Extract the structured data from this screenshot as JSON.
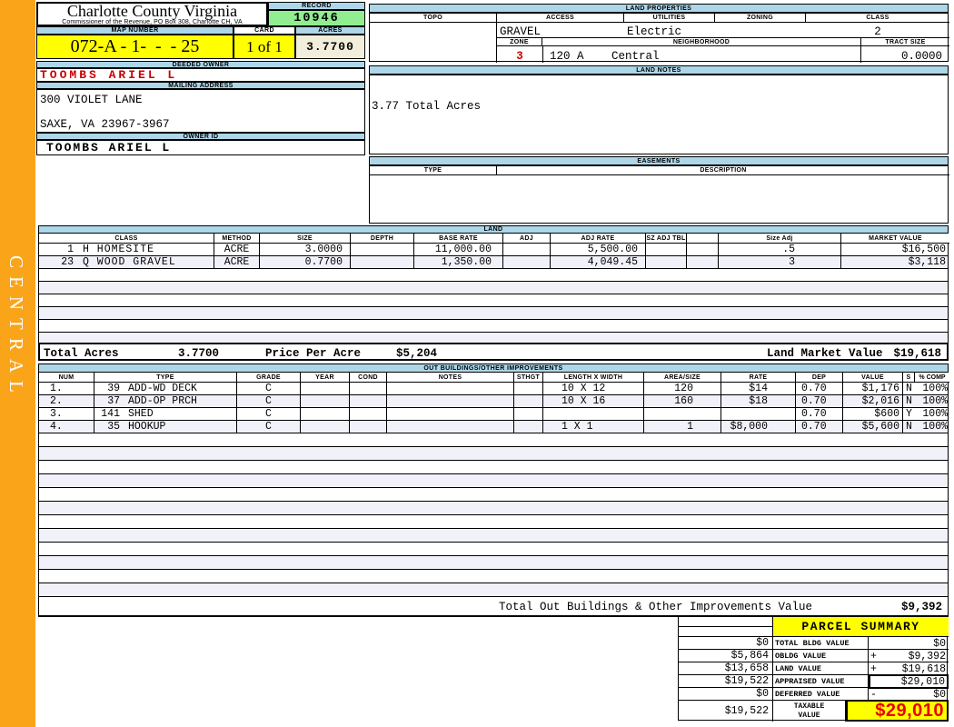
{
  "colors": {
    "sidebar_orange": "#FAA41A",
    "header_blue": "#ADD6E8",
    "record_green": "#90EE90",
    "highlight_yellow": "#FFFF00",
    "acres_cream": "#F1EFDC",
    "owner_red": "#CC0000",
    "taxable_red": "#E80000",
    "row_tint": "#F1F1F9"
  },
  "district": "CENTRAL",
  "header": {
    "county_name": "Charlotte County Virginia",
    "commissioner_line": "Commissioner of the Revenue, PO Box 308, Charlotte CH, VA",
    "record_label": "RECORD",
    "record_value": "10946",
    "map_number_label": "MAP NUMBER",
    "map_number": "072-A - 1-  -  - 25",
    "card_label": "CARD",
    "card_value": "1 of 1",
    "acres_label": "ACRES",
    "acres_value": "3.7700"
  },
  "owner": {
    "deeded_owner_label": "DEEDED OWNER",
    "deeded_owner": "TOOMBS ARIEL L",
    "mailing_address_label": "MAILING ADDRESS",
    "address_line1": "300 VIOLET LANE",
    "address_line2": "SAXE, VA 23967-3967",
    "owner_id_label": "OWNER ID",
    "owner_id": "TOOMBS ARIEL L"
  },
  "land_properties": {
    "title": "LAND PROPERTIES",
    "topo_label": "TOPO",
    "topo": "",
    "access_label": "ACCESS",
    "access": "GRAVEL",
    "utilities_label": "UTILITIES",
    "utilities": "Electric",
    "zoning_label": "ZONING",
    "zoning": "",
    "class_label": "CLASS",
    "class": "2",
    "zone_label": "ZONE",
    "zone": "3",
    "neighborhood_label": "NEIGHBORHOOD",
    "neighborhood_code": "120 A",
    "neighborhood_name": "Central",
    "tract_size_label": "TRACT SIZE",
    "tract_size": "0.0000"
  },
  "land_notes": {
    "title": "LAND NOTES",
    "note": "3.77 Total Acres"
  },
  "easements": {
    "title": "EASEMENTS",
    "type_label": "TYPE",
    "description_label": "DESCRIPTION"
  },
  "land": {
    "title": "LAND",
    "headers": {
      "class_col": "CLASS",
      "method": "METHOD",
      "size": "SIZE",
      "depth": "DEPTH",
      "base_rate": "BASE RATE",
      "adj": "ADJ",
      "adj_rate": "ADJ RATE",
      "sz_adj_tbl": "SZ ADJ TBL",
      "size_adj": "Size Adj",
      "market_value": "MARKET VALUE"
    },
    "rows": [
      {
        "num": "1",
        "class_name": "H HOMESITE",
        "method": "ACRE",
        "size": "3.0000",
        "base_rate": "11,000.00",
        "adj_rate": "5,500.00",
        "size_adj": ".5",
        "market_value": "$16,500"
      },
      {
        "num": "23",
        "class_name": "Q WOOD GRAVEL",
        "method": "ACRE",
        "size": "0.7700",
        "base_rate": "1,350.00",
        "adj_rate": "4,049.45",
        "size_adj": "3",
        "market_value": "$3,118"
      }
    ],
    "total_acres_label": "Total Acres",
    "total_acres": "3.7700",
    "price_per_acre_label": "Price Per Acre",
    "price_per_acre": "$5,204",
    "market_value_label": "Land Market Value",
    "market_value": "$19,618"
  },
  "outbuildings": {
    "title": "OUT BUILDINGS/OTHER IMPROVEMENTS",
    "headers": {
      "num": "NUM",
      "type": "TYPE",
      "grade": "GRADE",
      "year": "YEAR",
      "cond": "COND",
      "notes": "NOTES",
      "sthgt": "STHGT",
      "length_width": "LENGTH X WIDTH",
      "area_size": "AREA/SIZE",
      "rate": "RATE",
      "dep": "DEP",
      "value": "VALUE",
      "sold": "S",
      "pct_comp": "% COMP"
    },
    "rows": [
      {
        "num": "1.",
        "code": "39",
        "type": "ADD-WD DECK",
        "grade": "C",
        "length_width": "10 X 12",
        "area": "120",
        "rate": "$14",
        "dep": "0.70",
        "value": "$1,176",
        "sold": "N",
        "comp": "100%"
      },
      {
        "num": "2.",
        "code": "37",
        "type": "ADD-OP PRCH",
        "grade": "C",
        "length_width": "10 X 16",
        "area": "160",
        "rate": "$18",
        "dep": "0.70",
        "value": "$2,016",
        "sold": "N",
        "comp": "100%"
      },
      {
        "num": "3.",
        "code": "141",
        "type": "SHED",
        "grade": "C",
        "length_width": "",
        "area": "",
        "rate": "",
        "dep": "0.70",
        "value": "$600",
        "sold": "Y",
        "comp": "100%"
      },
      {
        "num": "4.",
        "code": "35",
        "type": "HOOKUP",
        "grade": "C",
        "length_width": "1 X 1",
        "area": "1",
        "rate": "$8,000",
        "dep": "0.70",
        "value": "$5,600",
        "sold": "N",
        "comp": "100%"
      }
    ],
    "total_label": "Total Out Buildings & Other Improvements Value",
    "total_value": "$9,392"
  },
  "parcel_summary": {
    "title": "PARCEL SUMMARY",
    "rows": [
      {
        "prev": "$0",
        "label": "TOTAL BLDG VALUE",
        "op": "",
        "value": "$0"
      },
      {
        "prev": "$5,864",
        "label": "OBLDG VALUE",
        "op": "+",
        "value": "$9,392"
      },
      {
        "prev": "$13,658",
        "label": "LAND VALUE",
        "op": "+",
        "value": "$19,618"
      },
      {
        "prev": "$19,522",
        "label": "APPRAISED VALUE",
        "op": "",
        "value": "$29,010"
      },
      {
        "prev": "$0",
        "label": "DEFERRED VALUE",
        "op": "-",
        "value": "$0"
      }
    ],
    "taxable": {
      "prev": "$19,522",
      "label": "TAXABLE VALUE",
      "value": "$29,010"
    }
  }
}
